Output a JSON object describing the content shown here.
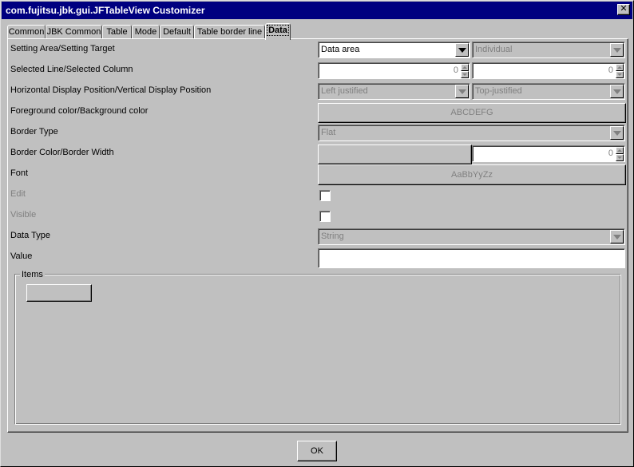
{
  "window": {
    "title": "com.fujitsu.jbk.gui.JFTableView Customizer",
    "close_glyph": "✕"
  },
  "tabs": [
    {
      "label": "Common"
    },
    {
      "label": "JBK Common"
    },
    {
      "label": "Table"
    },
    {
      "label": "Mode"
    },
    {
      "label": "Default"
    },
    {
      "label": "Table border line"
    },
    {
      "label": "Data"
    }
  ],
  "form": {
    "setting_area": {
      "label": "Setting Area/Setting Target",
      "area_value": "Data area",
      "target_value": "Individual"
    },
    "selected": {
      "label": "Selected Line/Selected Column",
      "line_value": "0",
      "column_value": "0"
    },
    "position": {
      "label": "Horizontal Display Position/Vertical Display Position",
      "horizontal_value": "Left justified",
      "vertical_value": "Top-justified"
    },
    "colors": {
      "label": "Foreground color/Background color",
      "sample": "ABCDEFG"
    },
    "border_type": {
      "label": "Border Type",
      "value": "Flat"
    },
    "border_color_width": {
      "label": "Border Color/Border Width",
      "width_value": "0"
    },
    "font": {
      "label": "Font",
      "sample": "AaBbYyZz"
    },
    "edit": {
      "label": "Edit"
    },
    "visible": {
      "label": "Visible"
    },
    "data_type": {
      "label": "Data Type",
      "value": "String"
    },
    "value_field": {
      "label": "Value",
      "value": ""
    }
  },
  "items_group": {
    "title": "Items",
    "button_label": ""
  },
  "footer": {
    "ok_label": "OK"
  }
}
